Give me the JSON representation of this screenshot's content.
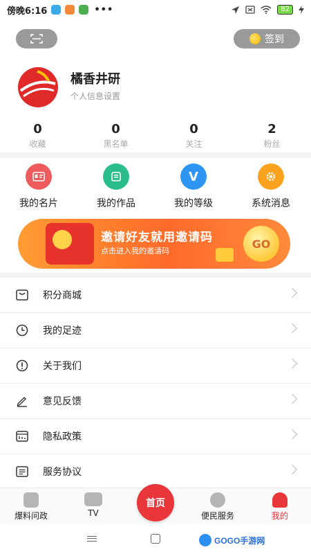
{
  "status_bar": {
    "time": "傍晚6:16",
    "dots": "•••",
    "battery": "82"
  },
  "header": {
    "signin_label": "签到"
  },
  "profile": {
    "username": "橘香井研",
    "settings_link": "个人信息设置"
  },
  "stats": [
    {
      "value": "0",
      "label": "收藏"
    },
    {
      "value": "0",
      "label": "黑名单"
    },
    {
      "value": "0",
      "label": "关注"
    },
    {
      "value": "2",
      "label": "粉丝"
    }
  ],
  "quick_actions": [
    {
      "label": "我的名片",
      "icon": "card-icon",
      "color": "#ee5b5f"
    },
    {
      "label": "我的作品",
      "icon": "works-icon",
      "color": "#2bbd8b"
    },
    {
      "label": "我的等级",
      "icon": "level-icon",
      "glyph": "V",
      "color": "#2e96f2"
    },
    {
      "label": "系统消息",
      "icon": "gear-icon",
      "color": "#f9a321"
    }
  ],
  "banner": {
    "title": "邀请好友就用邀请码",
    "subtitle": "点击进入我的邀请码",
    "go": "GO"
  },
  "menu": [
    {
      "label": "积分商城",
      "icon": "mall-icon"
    },
    {
      "label": "我的足迹",
      "icon": "clock-icon"
    },
    {
      "label": "关于我们",
      "icon": "info-icon"
    },
    {
      "label": "意见反馈",
      "icon": "pen-icon"
    },
    {
      "label": "隐私政策",
      "icon": "privacy-icon"
    },
    {
      "label": "服务协议",
      "icon": "agreement-icon"
    }
  ],
  "tabs": [
    {
      "label": "爆料问政",
      "icon": "report-icon"
    },
    {
      "label": "TV",
      "icon": "tv-icon"
    },
    {
      "label": "首页",
      "icon": "home-icon"
    },
    {
      "label": "便民服务",
      "icon": "service-icon"
    },
    {
      "label": "我的",
      "icon": "user-icon",
      "active": true
    }
  ],
  "colors": {
    "accent": "#e8363a",
    "active_tab": "#e8363a"
  },
  "watermark": {
    "text": "GOGO手游网"
  }
}
